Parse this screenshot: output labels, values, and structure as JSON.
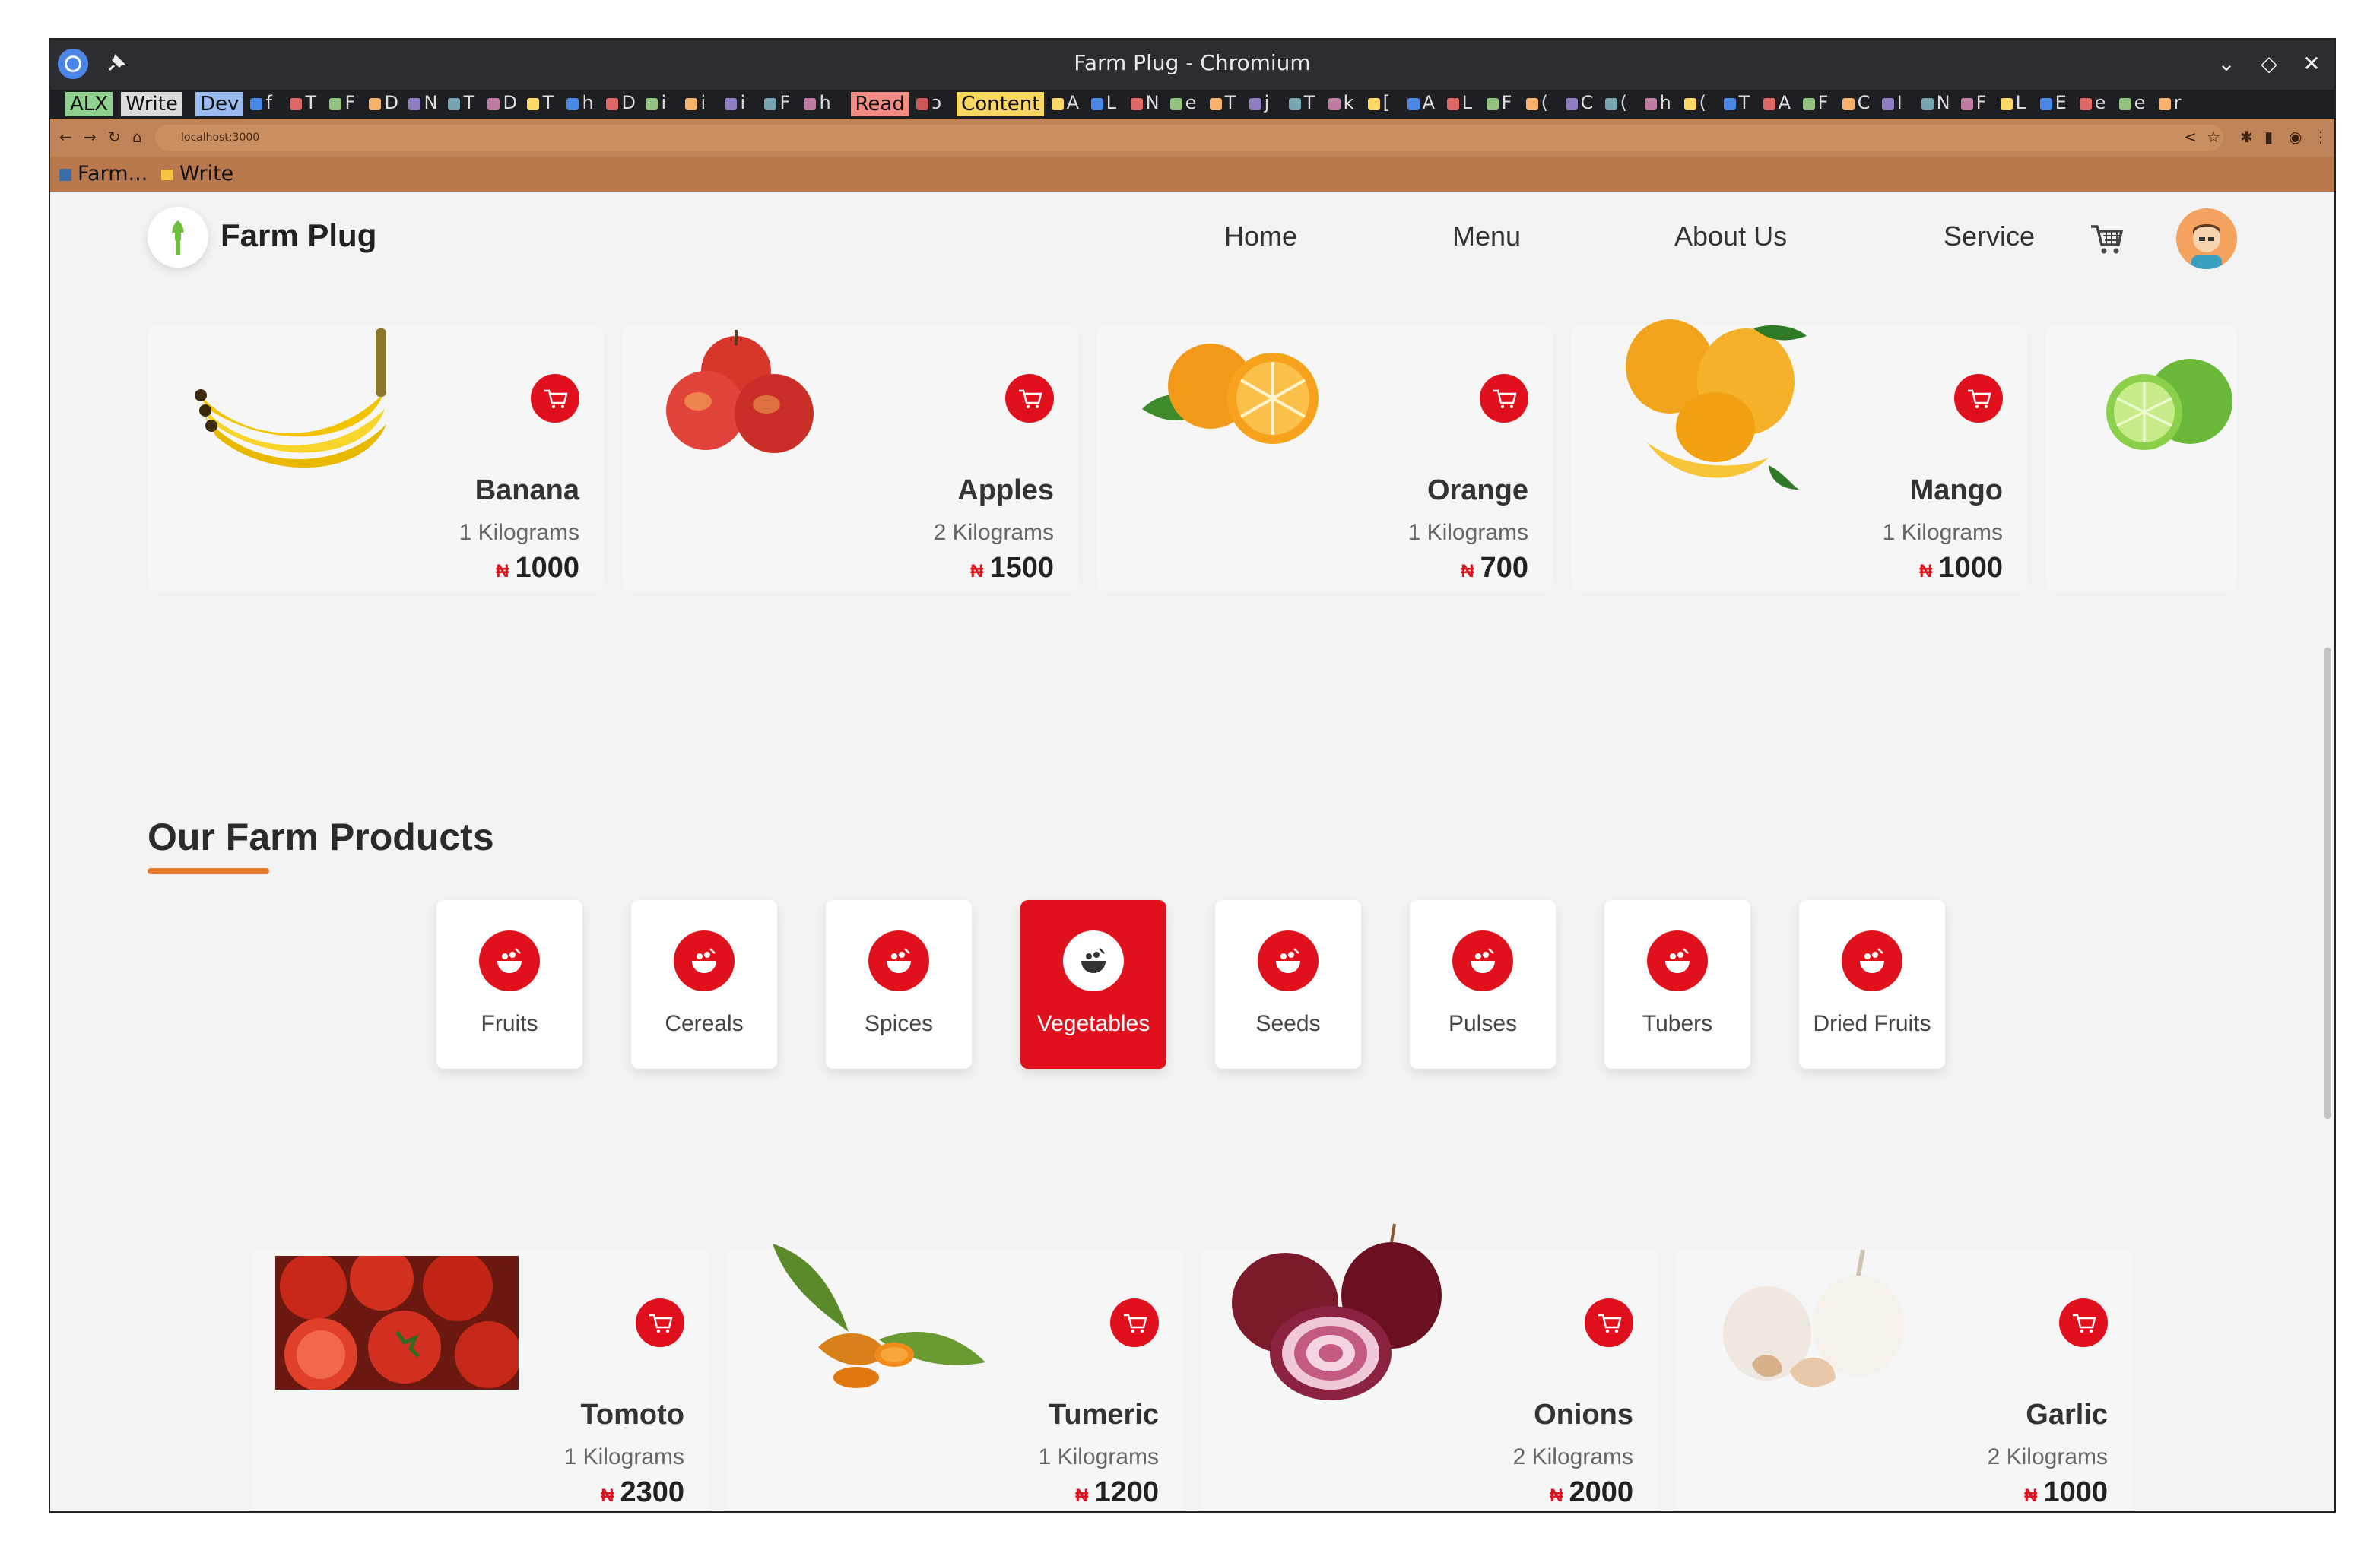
{
  "window": {
    "title": "Farm Plug - Chromium"
  },
  "tabs": {
    "labels": [
      "ALX",
      "Write",
      "Dev",
      "Read",
      "Content"
    ],
    "minis": [
      "f",
      "T",
      "F",
      "D",
      "N",
      "T",
      "D",
      "T",
      "h",
      "D",
      "i",
      "i",
      "i",
      "F",
      "h",
      "A",
      "L",
      "N",
      "e",
      "T",
      "j",
      "T",
      "k",
      "[",
      "A",
      "L",
      "F",
      "(",
      "C",
      "(",
      "h",
      "(",
      "T",
      "A",
      "F",
      "C",
      "I",
      "N",
      "F",
      "L",
      "E",
      "e",
      "e",
      "r"
    ]
  },
  "browser": {
    "url": "localhost:3000"
  },
  "bookmarks": {
    "farm": "Farm...",
    "write": "Write"
  },
  "header": {
    "brand": "Farm Plug",
    "nav": {
      "home": "Home",
      "menu": "Menu",
      "about": "About Us",
      "service": "Service"
    }
  },
  "currency": "₦",
  "top_products": [
    {
      "name": "Banana",
      "qty": "1 Kilograms",
      "price": "1000"
    },
    {
      "name": "Apples",
      "qty": "2 Kilograms",
      "price": "1500"
    },
    {
      "name": "Orange",
      "qty": "1 Kilograms",
      "price": "700"
    },
    {
      "name": "Mango",
      "qty": "1 Kilograms",
      "price": "1000"
    }
  ],
  "section": {
    "title": "Our Farm Products"
  },
  "categories": [
    "Fruits",
    "Cereals",
    "Spices",
    "Vegetables",
    "Seeds",
    "Pulses",
    "Tubers",
    "Dried Fruits"
  ],
  "active_category": "Vegetables",
  "veg_products": [
    {
      "name": "Tomoto",
      "qty": "1 Kilograms",
      "price": "2300"
    },
    {
      "name": "Tumeric",
      "qty": "1 Kilograms",
      "price": "1200"
    },
    {
      "name": "Onions",
      "qty": "2 Kilograms",
      "price": "2000"
    },
    {
      "name": "Garlic",
      "qty": "2 Kilograms",
      "price": "1000"
    }
  ],
  "colors": {
    "accent": "#e0101d",
    "underline": "#e8782e",
    "browser_chrome": "#bf8457"
  }
}
